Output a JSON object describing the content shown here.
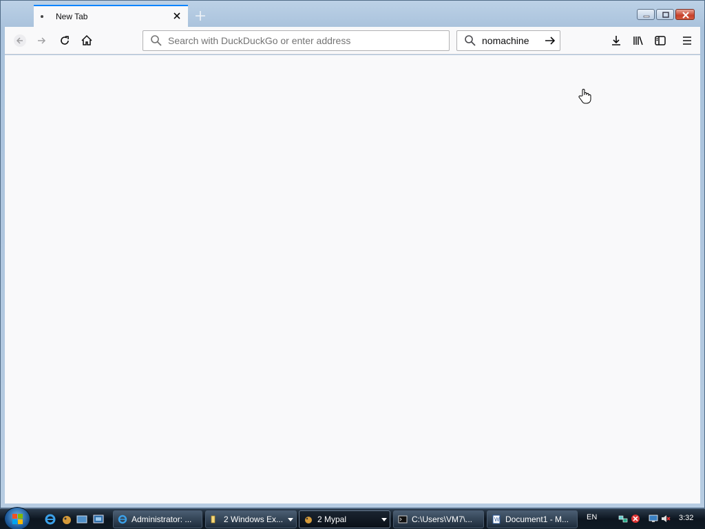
{
  "browser": {
    "tab": {
      "title": "New Tab"
    },
    "url_bar": {
      "placeholder": "Search with DuckDuckGo or enter address",
      "value": ""
    },
    "search_bar": {
      "value": "nomachine"
    }
  },
  "taskbar": {
    "buttons": [
      {
        "label": "Administrator: ...",
        "icon": "ie-icon"
      },
      {
        "label": "2 Windows Ex...",
        "icon": "folder-icon"
      },
      {
        "label": "2 Mypal",
        "icon": "mypal-icon"
      },
      {
        "label": "C:\\Users\\VM7\\...",
        "icon": "cmd-icon"
      },
      {
        "label": "Document1 - M...",
        "icon": "word-icon"
      }
    ],
    "language": "EN",
    "clock": "3:32"
  },
  "colors": {
    "accent": "#0a84ff",
    "content_bg": "#f9f9fa"
  }
}
